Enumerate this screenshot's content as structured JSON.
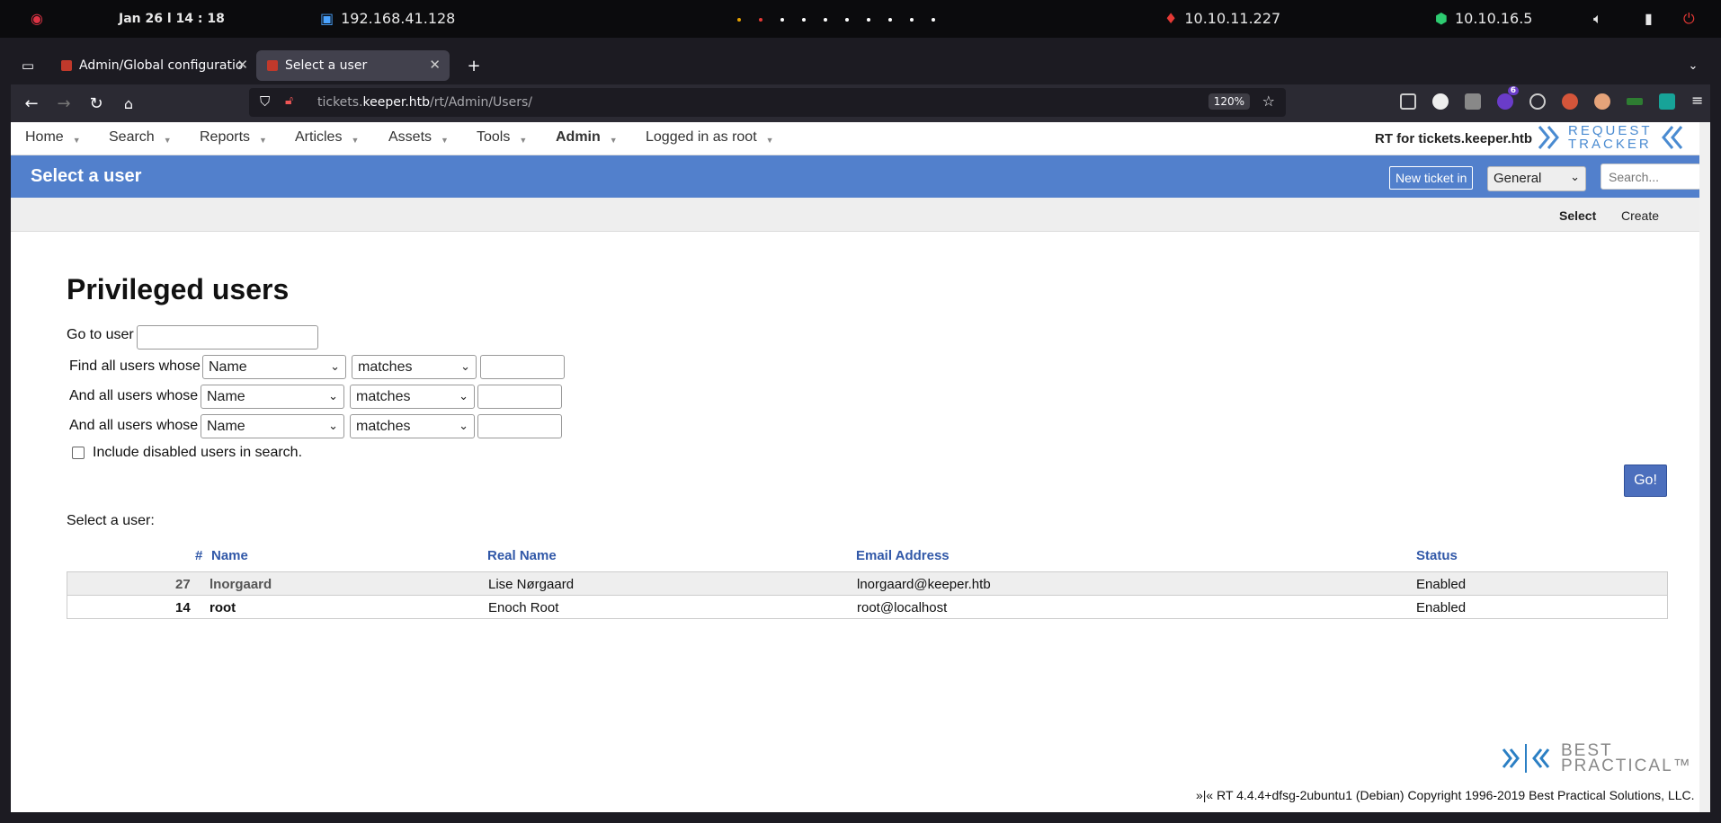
{
  "system_bar": {
    "datetime": "Jan 26  l 14 : 18",
    "vpn_ip": "192.168.41.128",
    "target_ip": "10.10.11.227",
    "tun_ip": "10.10.16.5"
  },
  "browser": {
    "tabs": [
      {
        "label": "Admin/Global configuratio"
      },
      {
        "label": "Select a user"
      }
    ],
    "url_prefix": "tickets.",
    "url_domain": "keeper.htb",
    "url_path": "/rt/Admin/Users/",
    "zoom": "120%",
    "extension_badge": "6"
  },
  "rt": {
    "menu": [
      {
        "label": "Home"
      },
      {
        "label": "Search"
      },
      {
        "label": "Reports"
      },
      {
        "label": "Articles"
      },
      {
        "label": "Assets"
      },
      {
        "label": "Tools"
      },
      {
        "label": "Admin"
      },
      {
        "label": "Logged in as root"
      }
    ],
    "rt_title": "RT for tickets.keeper.htb",
    "logo": [
      "REQUEST",
      "TRACKER"
    ],
    "header_title": "Select a user",
    "new_ticket_label": "New ticket in",
    "queue_selected": "General",
    "search_placeholder": "Search...",
    "subtabs": [
      {
        "label": "Select"
      },
      {
        "label": "Create"
      }
    ],
    "page_title": "Privileged users",
    "goto_label": "Go to user",
    "filters": [
      {
        "label": "Find all users whose",
        "field": "Name",
        "op": "matches",
        "value": ""
      },
      {
        "label": "And all users whose",
        "field": "Name",
        "op": "matches",
        "value": ""
      },
      {
        "label": "And all users whose",
        "field": "Name",
        "op": "matches",
        "value": ""
      }
    ],
    "include_disabled_label": "Include disabled users in search.",
    "go_label": "Go!",
    "select_label": "Select a user:",
    "columns": [
      "#",
      "Name",
      "Real Name",
      "Email Address",
      "Status"
    ],
    "users": [
      {
        "id": "27",
        "name": "lnorgaard",
        "real_name": "Lise Nørgaard",
        "email": "lnorgaard@keeper.htb",
        "status": "Enabled"
      },
      {
        "id": "14",
        "name": "root",
        "real_name": "Enoch Root",
        "email": "root@localhost",
        "status": "Enabled"
      }
    ],
    "bp_logo": [
      "BEST",
      "PRACTICAL™"
    ],
    "footer": "»|« RT 4.4.4+dfsg-2ubuntu1 (Debian) Copyright 1996-2019 Best Practical Solutions, LLC."
  }
}
